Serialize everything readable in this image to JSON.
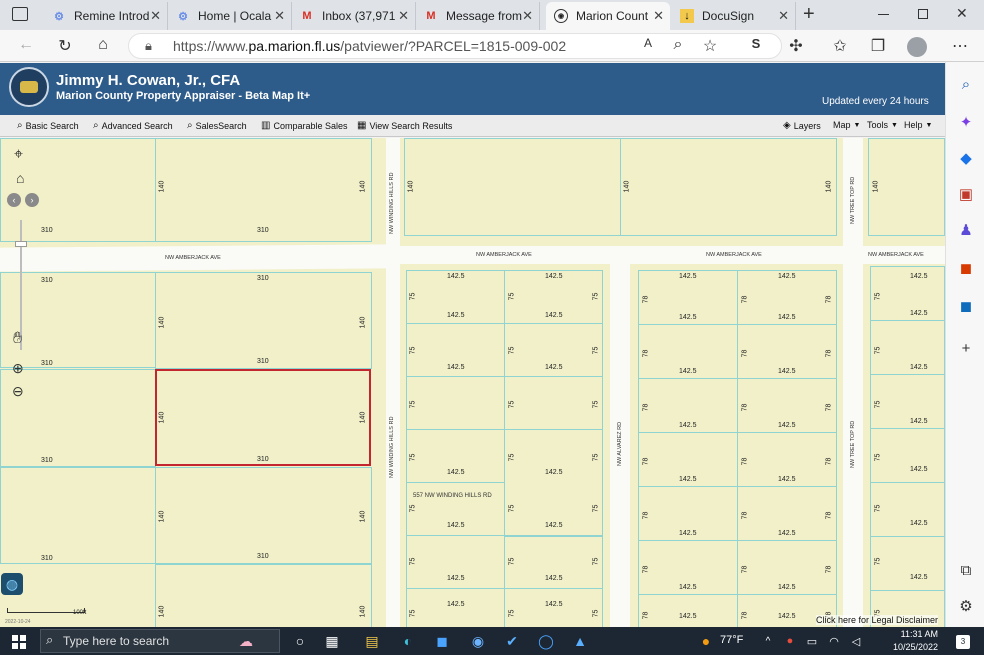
{
  "browser": {
    "tabs": [
      {
        "title": "Remine Introd",
        "icon": "gear-icon",
        "icon_color": "#6b8ee6"
      },
      {
        "title": "Home | Ocala",
        "icon": "gear-icon",
        "icon_color": "#6b8ee6"
      },
      {
        "title": "Inbox (37,971",
        "icon": "gmail-icon",
        "icon_color": "#d93025"
      },
      {
        "title": "Message from",
        "icon": "gmail-icon",
        "icon_color": "#d93025"
      },
      {
        "title": "Marion Count",
        "icon": "seal-icon",
        "icon_color": "#333"
      },
      {
        "title": "DocuSign",
        "icon": "docusign-icon",
        "icon_color": "#f2c94c"
      }
    ],
    "url_prefix": "https://www.",
    "url_host": "pa.marion.fl.us",
    "url_path": "/patviewer/?PARCEL=1815-009-002"
  },
  "site": {
    "title": "Jimmy H. Cowan, Jr., CFA",
    "subtitle": "Marion County Property Appraiser - Beta Map It+",
    "updated": "Updated every 24 hours"
  },
  "toolbar": {
    "basic_search": "Basic Search",
    "advanced_search": "Advanced Search",
    "sales_search": "SalesSearch",
    "comparable_sales": "Comparable Sales",
    "view_results": "View Search Results",
    "layers": "Layers",
    "map": "Map",
    "tools": "Tools",
    "help": "Help"
  },
  "map": {
    "road_amberjack": "NW AMBERJACK AVE",
    "road_winding": "NW WINDING HILLS RD",
    "road_alvarez": "NW ALVAREZ RD",
    "road_treetop": "NW TREE TOP RD",
    "address_label": "557 NW WINDING HILLS RD",
    "scale": "100ft",
    "date": "2022-10-24",
    "disclaimer": "Click here for Legal Disclaimer",
    "dim_310": "310",
    "dim_140": "140",
    "dim_142": "142.5",
    "dim_75": "75",
    "dim_78": "78"
  },
  "taskbar": {
    "search_placeholder": "Type here to search",
    "weather": "77°F",
    "time": "11:31 AM",
    "date": "10/25/2022",
    "notifications": "3"
  }
}
